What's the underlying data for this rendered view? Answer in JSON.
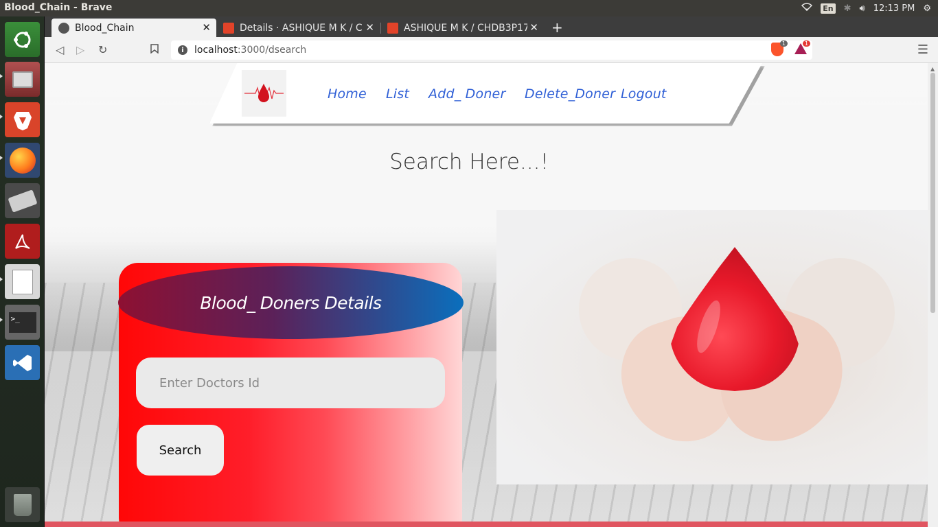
{
  "system": {
    "window_title": "Blood_Chain - Brave",
    "keyboard_layout": "En",
    "clock": "12:13 PM"
  },
  "browser": {
    "tabs": [
      {
        "title": "Blood_Chain",
        "active": true
      },
      {
        "title": "Details · ASHIQUE M K / CH",
        "active": false
      },
      {
        "title": "ASHIQUE M K / CHDB3P17",
        "active": false
      }
    ],
    "url_host": "localhost",
    "url_path": ":3000/dsearch",
    "shield_badge": "1",
    "rewards_badge": "1"
  },
  "launcher": {
    "apps": [
      "ubuntu-dash-icon",
      "files-icon",
      "brave-icon",
      "firefox-icon",
      "scanner-icon",
      "pdf-reader-icon",
      "text-editor-icon",
      "terminal-icon",
      "vscode-icon",
      "trash-icon"
    ]
  },
  "nav": {
    "links": [
      "Home",
      "List",
      "Add_ Doner",
      "Delete_Doner",
      "Logout"
    ]
  },
  "page": {
    "heading": "Search Here...!",
    "card_title": "Blood_ Doners Details",
    "input_placeholder": "Enter Doctors Id",
    "search_label": "Search"
  },
  "colors": {
    "nav_link": "#2f5fd6",
    "card_red": "#ff0707",
    "ellipse_blue": "#0a6fbd",
    "footer": "#e05560"
  }
}
